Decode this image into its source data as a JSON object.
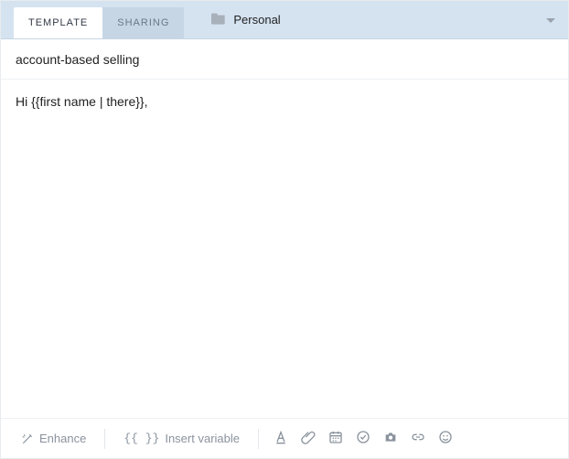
{
  "tabs": [
    {
      "label": "TEMPLATE",
      "active": true
    },
    {
      "label": "SHARING",
      "active": false
    }
  ],
  "folder": {
    "name": "Personal"
  },
  "subject": {
    "value": "account-based selling"
  },
  "body": {
    "text": "Hi {{first name | there}},"
  },
  "toolbar": {
    "enhance_label": "Enhance",
    "variable_glyph": "{{ }}",
    "variable_label": "Insert variable"
  }
}
